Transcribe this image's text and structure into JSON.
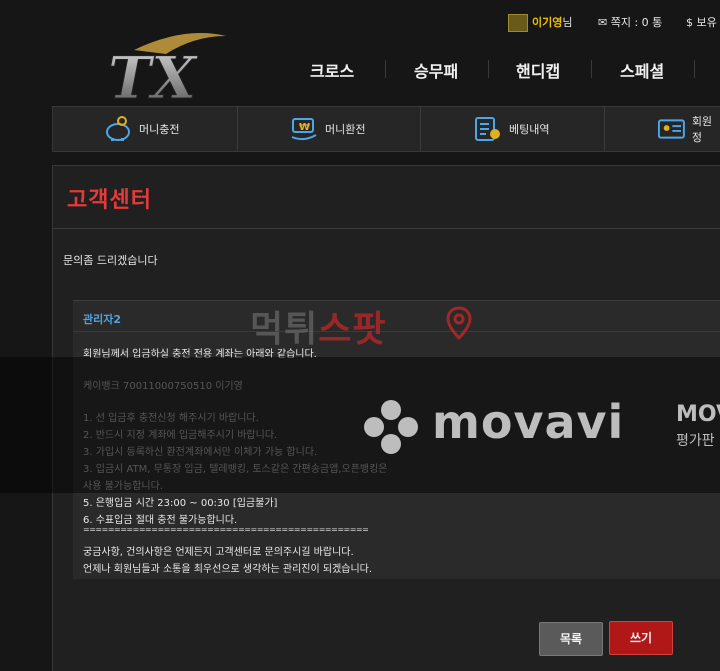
{
  "header": {
    "user": {
      "name": "이기영",
      "suffix": "님"
    },
    "messages": "쪽지 : 0 통",
    "balance_label": "$ 보유"
  },
  "logo_text": "TX",
  "nav": {
    "items": [
      {
        "label": "크로스"
      },
      {
        "label": "승무패"
      },
      {
        "label": "핸디캡"
      },
      {
        "label": "스페셜"
      }
    ]
  },
  "subnav": {
    "items": [
      {
        "label": "머니충전",
        "icon": "piggy-bank-icon"
      },
      {
        "label": "머니환전",
        "icon": "money-exchange-icon"
      },
      {
        "label": "베팅내역",
        "icon": "betting-history-icon"
      },
      {
        "label": "회원정",
        "icon": "member-card-icon"
      }
    ]
  },
  "board": {
    "title": "고객센터",
    "subject": "문의좀 드리겠습니다",
    "post": {
      "author": "관리자2",
      "lines": [
        "회원님께서 입금하실 충전 전용 계좌는 아래와 같습니다.",
        "케이뱅크 70011000750510 이기영",
        "1. 선 입금후 충전신청 해주시기 바랍니다.",
        "2. 반드시 지정 계좌에 입금해주시기 바랍니다.",
        "3. 가입시 등록하신 환전계좌에서만 이체가 가능 합니다.",
        "3. 입금시 ATM, 무통장 입금, 텔레뱅킹, 토스같은 간편송금앱,오픈뱅킹은",
        "사용 불가능합니다.",
        "5. 은행입금 시간 23:00 ~ 00:30 [입금불가]",
        "6. 수표입금 절대 충전 불가능합니다.",
        "==============================================",
        "궁금사항, 건의사항은 언제든지 고객센터로 문의주시길 바랍니다.",
        "언제나 회원님들과 소통을 최우선으로 생각하는 관리진이 되겠습니다."
      ]
    },
    "buttons": {
      "list": "목록",
      "write": "쓰기"
    }
  },
  "watermark": {
    "brand": "movavi",
    "brand_cut": "MOV",
    "sub": "평가판",
    "stamp_a": "먹튀",
    "stamp_b": "스팟"
  },
  "colors": {
    "accent_red": "#e63a3a",
    "author_blue": "#4fa3e0",
    "gold": "#f0c000"
  }
}
